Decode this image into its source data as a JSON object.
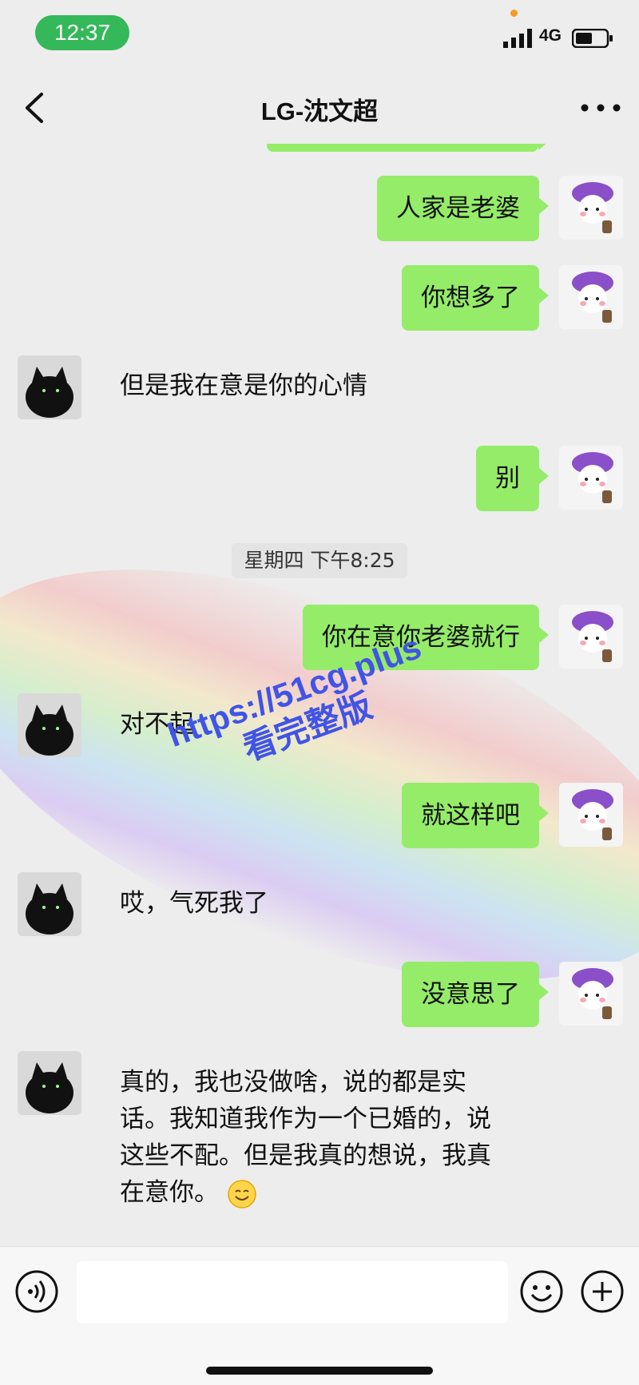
{
  "status_bar": {
    "time": "12:37",
    "network": "4G"
  },
  "nav": {
    "title": "LG-沈文超"
  },
  "messages": [
    {
      "side": "out",
      "text": "人家是老婆"
    },
    {
      "side": "out",
      "text": "你想多了"
    },
    {
      "side": "in",
      "text": "但是我在意是你的心情"
    },
    {
      "side": "out",
      "text": "别"
    },
    {
      "type": "timestamp",
      "text": "星期四 下午8:25"
    },
    {
      "side": "out",
      "text": "你在意你老婆就行"
    },
    {
      "side": "in",
      "text": "对不起"
    },
    {
      "side": "out",
      "text": "就这样吧"
    },
    {
      "side": "in",
      "text": "哎，气死我了"
    },
    {
      "side": "out",
      "text": "没意思了"
    },
    {
      "side": "in",
      "text": "真的，我也没做啥，说的都是实话。我知道我作为一个已婚的，说这些不配。但是我真的想说，我真在意你。"
    }
  ],
  "watermark": {
    "line1": "https://51cg.plus",
    "line2": "看完整版"
  },
  "colors": {
    "outgoing_bubble": "#95ec69",
    "time_pill": "#34b859",
    "background": "#ededed"
  }
}
